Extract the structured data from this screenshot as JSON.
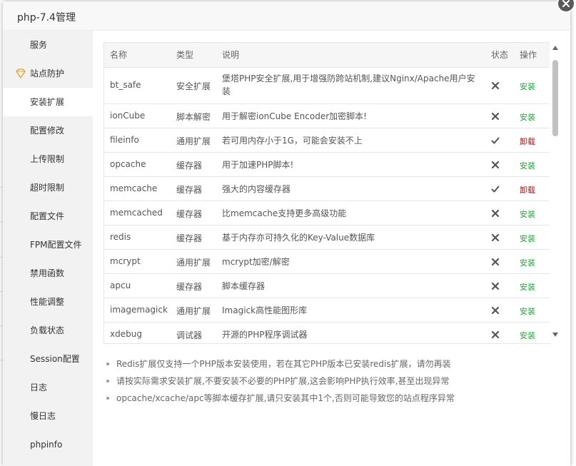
{
  "dialog": {
    "title": "php-7.4管理",
    "close_icon": "close-icon"
  },
  "sidebar": {
    "items": [
      {
        "label": "服务",
        "active": false
      },
      {
        "label": "站点防护",
        "active": false,
        "icon": "shield-diamond-icon"
      },
      {
        "label": "安装扩展",
        "active": true
      },
      {
        "label": "配置修改",
        "active": false
      },
      {
        "label": "上传限制",
        "active": false
      },
      {
        "label": "超时限制",
        "active": false
      },
      {
        "label": "配置文件",
        "active": false
      },
      {
        "label": "FPM配置文件",
        "active": false
      },
      {
        "label": "禁用函数",
        "active": false
      },
      {
        "label": "性能调整",
        "active": false
      },
      {
        "label": "负载状态",
        "active": false
      },
      {
        "label": "Session配置",
        "active": false
      },
      {
        "label": "日志",
        "active": false
      },
      {
        "label": "慢日志",
        "active": false
      },
      {
        "label": "phpinfo",
        "active": false
      }
    ]
  },
  "table": {
    "headers": {
      "name": "名称",
      "type": "类型",
      "desc": "说明",
      "status": "状态",
      "action": "操作"
    },
    "rows": [
      {
        "name": "bt_safe",
        "type": "安全扩展",
        "desc": "堡塔PHP安全扩展,用于增强防跨站机制,建议Nginx/Apache用户安装",
        "installed": false,
        "action": "安装"
      },
      {
        "name": "ionCube",
        "type": "脚本解密",
        "desc": "用于解密ionCube Encoder加密脚本!",
        "installed": false,
        "action": "安装"
      },
      {
        "name": "fileinfo",
        "type": "通用扩展",
        "desc": "若可用内存小于1G，可能会安装不上",
        "installed": true,
        "action": "卸载"
      },
      {
        "name": "opcache",
        "type": "缓存器",
        "desc": "用于加速PHP脚本!",
        "installed": false,
        "action": "安装"
      },
      {
        "name": "memcache",
        "type": "缓存器",
        "desc": "强大的内容缓存器",
        "installed": true,
        "action": "卸载"
      },
      {
        "name": "memcached",
        "type": "缓存器",
        "desc": "比memcache支持更多高级功能",
        "installed": false,
        "action": "安装"
      },
      {
        "name": "redis",
        "type": "缓存器",
        "desc": "基于内存亦可持久化的Key-Value数据库",
        "installed": false,
        "action": "安装"
      },
      {
        "name": "mcrypt",
        "type": "通用扩展",
        "desc": "mcrypt加密/解密",
        "installed": false,
        "action": "安装"
      },
      {
        "name": "apcu",
        "type": "缓存器",
        "desc": "脚本缓存器",
        "installed": false,
        "action": "安装"
      },
      {
        "name": "imagemagick",
        "type": "通用扩展",
        "desc": "Imagick高性能图形库",
        "installed": false,
        "action": "安装"
      },
      {
        "name": "xdebug",
        "type": "调试器",
        "desc": "开源的PHP程序调试器",
        "installed": false,
        "action": "安装"
      }
    ]
  },
  "notes": [
    "Redis扩展仅支持一个PHP版本安装使用，若在其它PHP版本已安装redis扩展，请勿再装",
    "请按实际需求安装扩展,不要安装不必要的PHP扩展,这会影响PHP执行效率,甚至出现异常",
    "opcache/xcache/apc等脚本缓存扩展,请只安装其中1个,否则可能导致您的站点程序异常"
  ],
  "colors": {
    "install": "#20a53a",
    "uninstall": "#cc0000",
    "sidebar_bg": "#f2f2f2",
    "header_bg": "#f6f6f6"
  },
  "icons": {
    "installed": "check-icon",
    "not_installed": "cross-icon",
    "scroll_up": "scroll-up-arrow-icon",
    "scroll_down": "scroll-down-arrow-icon"
  }
}
